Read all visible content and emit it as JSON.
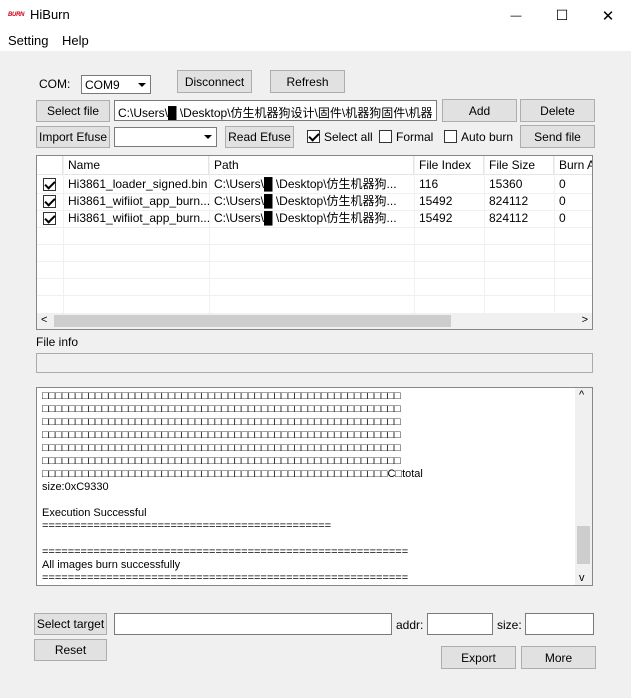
{
  "window": {
    "logo_text": "BURN",
    "title": "HiBurn",
    "minimize_glyph": "—",
    "maximize_glyph": "☐",
    "close_glyph": "✕"
  },
  "menu": {
    "items": [
      "Setting",
      "Help"
    ]
  },
  "com": {
    "label": "COM:",
    "selected": "COM9",
    "disconnect_label": "Disconnect",
    "refresh_label": "Refresh"
  },
  "file_row": {
    "select_file_label": "Select file",
    "path_value": "C:\\Users\\█ \\Desktop\\仿生机器狗设计\\固件\\机器狗固件\\机器",
    "add_label": "Add",
    "delete_label": "Delete"
  },
  "efuse_row": {
    "import_efuse_label": "Import Efuse",
    "efuse_value": "",
    "read_efuse_label": "Read Efuse",
    "select_all_label": "Select all",
    "select_all_checked": true,
    "formal_label": "Formal",
    "formal_checked": false,
    "auto_burn_label": "Auto burn",
    "auto_burn_checked": false,
    "send_file_label": "Send file"
  },
  "file_list": {
    "columns": [
      "Name",
      "Path",
      "File Index",
      "File Size",
      "Burn A"
    ],
    "rows": [
      {
        "checked": true,
        "name": "Hi3861_loader_signed.bin",
        "path": "C:\\Users\\█ \\Desktop\\仿生机器狗...",
        "index": "116",
        "size": "15360",
        "burn": "0"
      },
      {
        "checked": true,
        "name": "Hi3861_wifiiot_app_burn...",
        "path": "C:\\Users\\█ \\Desktop\\仿生机器狗...",
        "index": "15492",
        "size": "824112",
        "burn": "0"
      },
      {
        "checked": true,
        "name": "Hi3861_wifiiot_app_burn...",
        "path": "C:\\Users\\█ \\Desktop\\仿生机器狗...",
        "index": "15492",
        "size": "824112",
        "burn": "0"
      }
    ],
    "scroll_left": "<",
    "scroll_right": ">"
  },
  "file_info": {
    "label": "File info",
    "value": ""
  },
  "log": {
    "text": "□□□□□□□□□□□□□□□□□□□□□□□□□□□□□□□□□□□□□□□□□□□□□□□□□□□□□□\n□□□□□□□□□□□□□□□□□□□□□□□□□□□□□□□□□□□□□□□□□□□□□□□□□□□□□□\n□□□□□□□□□□□□□□□□□□□□□□□□□□□□□□□□□□□□□□□□□□□□□□□□□□□□□□\n□□□□□□□□□□□□□□□□□□□□□□□□□□□□□□□□□□□□□□□□□□□□□□□□□□□□□□\n□□□□□□□□□□□□□□□□□□□□□□□□□□□□□□□□□□□□□□□□□□□□□□□□□□□□□□\n□□□□□□□□□□□□□□□□□□□□□□□□□□□□□□□□□□□□□□□□□□□□□□□□□□□□□□\n□□□□□□□□□□□□□□□□□□□□□□□□□□□□□□□□□□□□□□□□□□□□□□□□□□□□C□total\nsize:0xC9330\n\nExecution Successful\n=============================================\n\n=========================================================\nAll images burn successfully\n=========================================================",
    "scroll_up": "^",
    "scroll_down": "v"
  },
  "bottom": {
    "select_target_label": "Select target",
    "target_value": "",
    "addr_label": "addr:",
    "addr_value": "",
    "size_label": "size:",
    "size_value": "",
    "reset_label": "Reset",
    "export_label": "Export",
    "more_label": "More"
  }
}
